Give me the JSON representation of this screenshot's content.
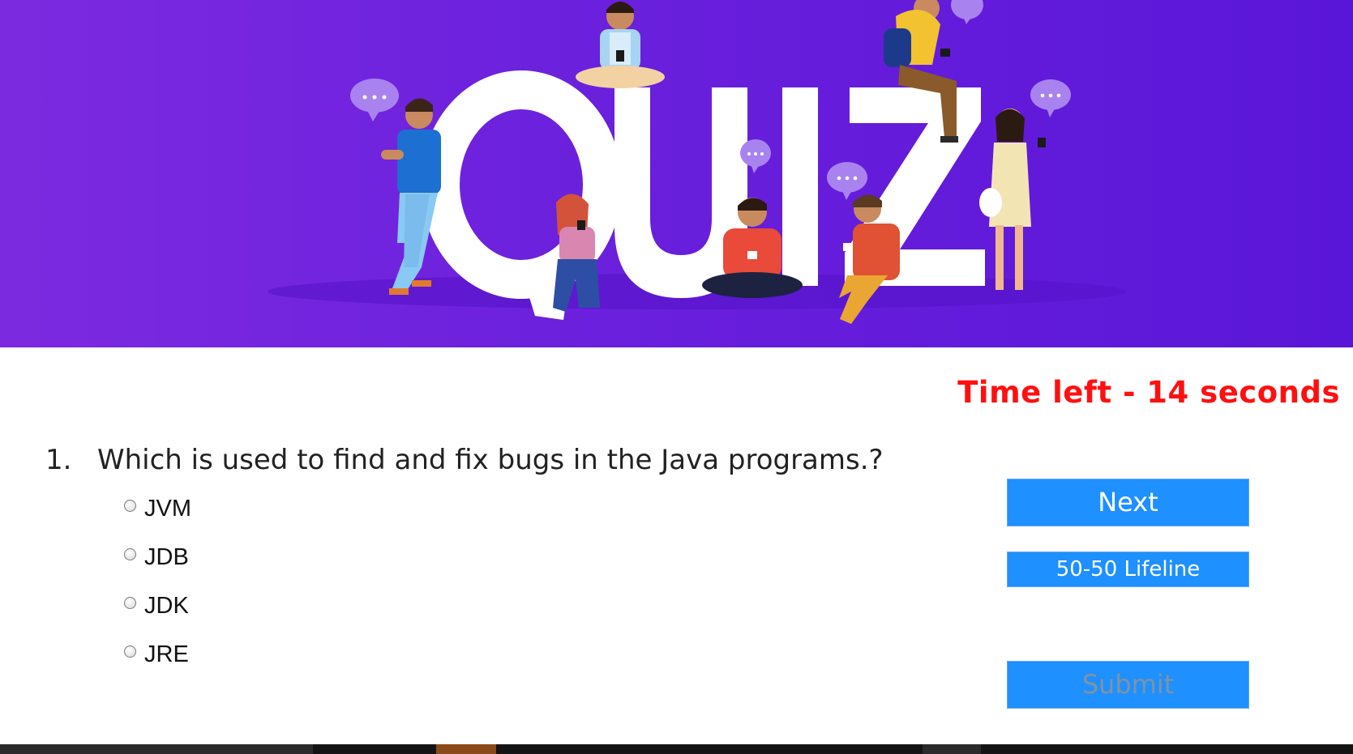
{
  "banner": {
    "alt": "QUIZ"
  },
  "timer": {
    "text": "Time left - 14 seconds"
  },
  "question": {
    "number": "1.",
    "text": "Which is used to find and fix bugs in the Java programs.?",
    "options": [
      "JVM",
      "JDB",
      "JDK",
      "JRE"
    ]
  },
  "buttons": {
    "next": "Next",
    "lifeline": "50-50 Lifeline",
    "submit": "Submit"
  },
  "colors": {
    "banner_start": "#7c2ae0",
    "banner_end": "#5a16d8",
    "timer": "#ff1010",
    "button_bg": "#1e90ff",
    "submit_text": "#7f93a3"
  },
  "icons": [
    "speech-bubble-icon"
  ]
}
